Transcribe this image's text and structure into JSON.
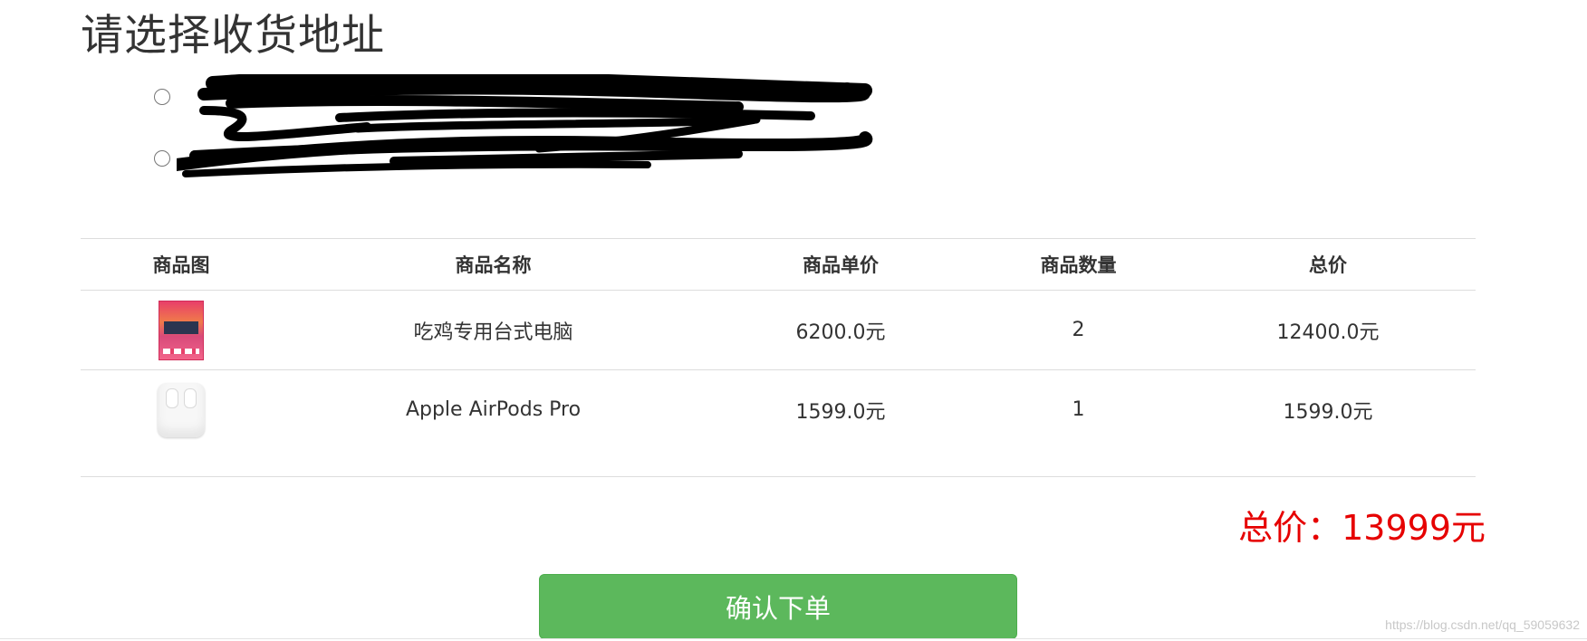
{
  "page": {
    "title": "请选择收货地址"
  },
  "addresses": [
    {
      "text": ""
    },
    {
      "text": ""
    }
  ],
  "table": {
    "headers": [
      "商品图",
      "商品名称",
      "商品单价",
      "商品数量",
      "总价"
    ],
    "rows": [
      {
        "image_icon": "gaming-pc-product-image",
        "name": "吃鸡专用台式电脑",
        "unit_price": "6200.0元",
        "quantity": "2",
        "total": "12400.0元"
      },
      {
        "image_icon": "airpods-product-image",
        "name": "Apple AirPods Pro",
        "unit_price": "1599.0元",
        "quantity": "1",
        "total": "1599.0元"
      }
    ]
  },
  "summary": {
    "grand_total": "总价：13999元"
  },
  "actions": {
    "confirm_label": "确认下单"
  },
  "watermark": "https://blog.csdn.net/qq_59059632",
  "colors": {
    "accent_button": "#5cb85c",
    "total_text": "#e60000"
  }
}
